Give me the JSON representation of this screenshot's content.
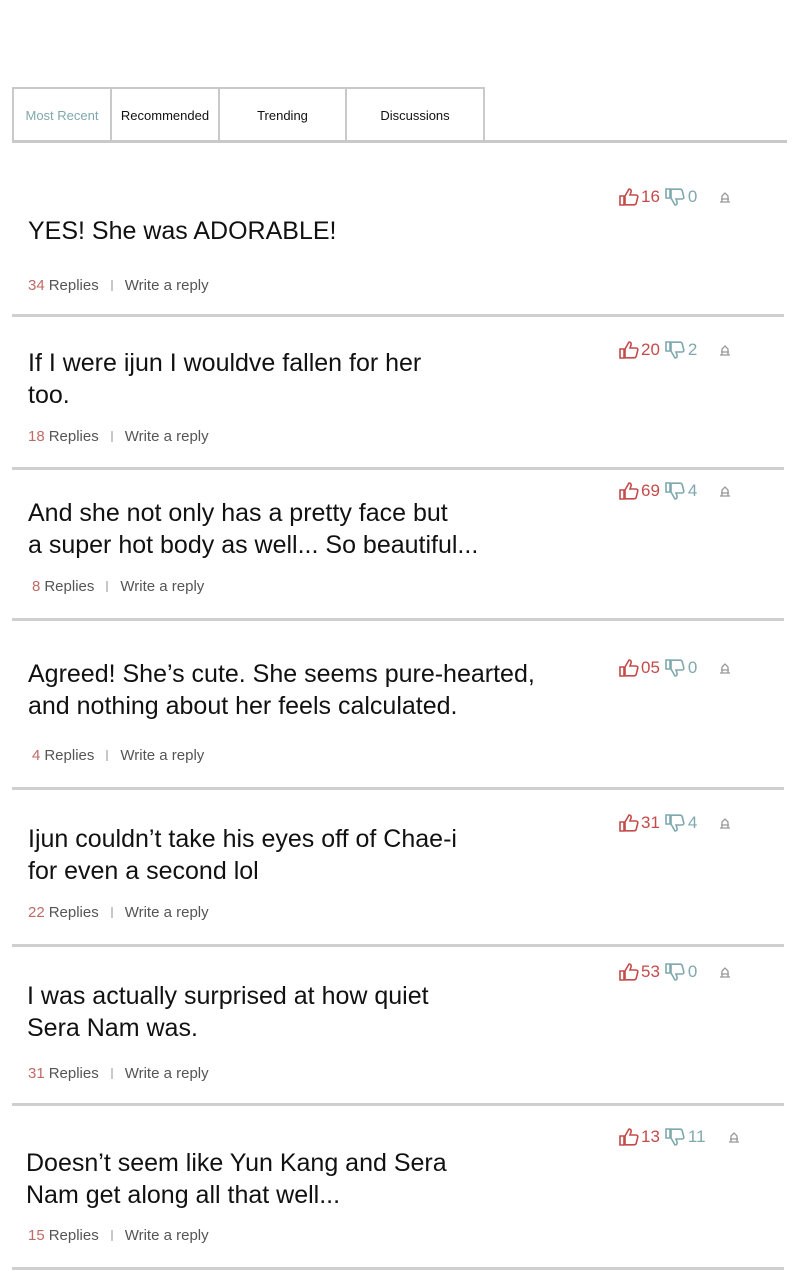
{
  "tabs": [
    {
      "label": "Most Recent",
      "active": true
    },
    {
      "label": "Recommended",
      "active": false
    },
    {
      "label": "Trending",
      "active": false
    },
    {
      "label": "Discussions",
      "active": false
    }
  ],
  "colors": {
    "accent_tab": "#7fa8ad",
    "like": "#c54a4a",
    "dislike": "#7fa8ad",
    "reply_count": "#c06a66",
    "divider": "#cfcfcf"
  },
  "icons": {
    "like": "thumbs-up-icon",
    "dislike": "thumbs-down-icon",
    "report": "report-icon"
  },
  "reply_label": "Replies",
  "write_label": "Write a reply",
  "comments": [
    {
      "text": "YES! She was ADORABLE!",
      "likes": "16",
      "dislikes": "0",
      "replies": "34"
    },
    {
      "text": "If I were ijun I wouldve fallen for her\ntoo.",
      "likes": "20",
      "dislikes": "2",
      "replies": "18"
    },
    {
      "text": "And she not only has a pretty face but\na super hot body as well... So beautiful...",
      "likes": "69",
      "dislikes": "4",
      "replies": "8"
    },
    {
      "text": "Agreed! She’s cute. She seems pure-hearted,\nand nothing about her feels calculated.",
      "likes": "05",
      "dislikes": "0",
      "replies": "4"
    },
    {
      "text": "Ijun couldn’t take his eyes off of Chae-i\nfor even a second lol",
      "likes": "31",
      "dislikes": "4",
      "replies": "22"
    },
    {
      "text": "I was actually surprised at how quiet\nSera Nam was.",
      "likes": "53",
      "dislikes": "0",
      "replies": "31"
    },
    {
      "text": "Doesn’t seem like Yun Kang and Sera\nNam get along all that well...",
      "likes": "13",
      "dislikes": "11",
      "replies": "15"
    }
  ]
}
